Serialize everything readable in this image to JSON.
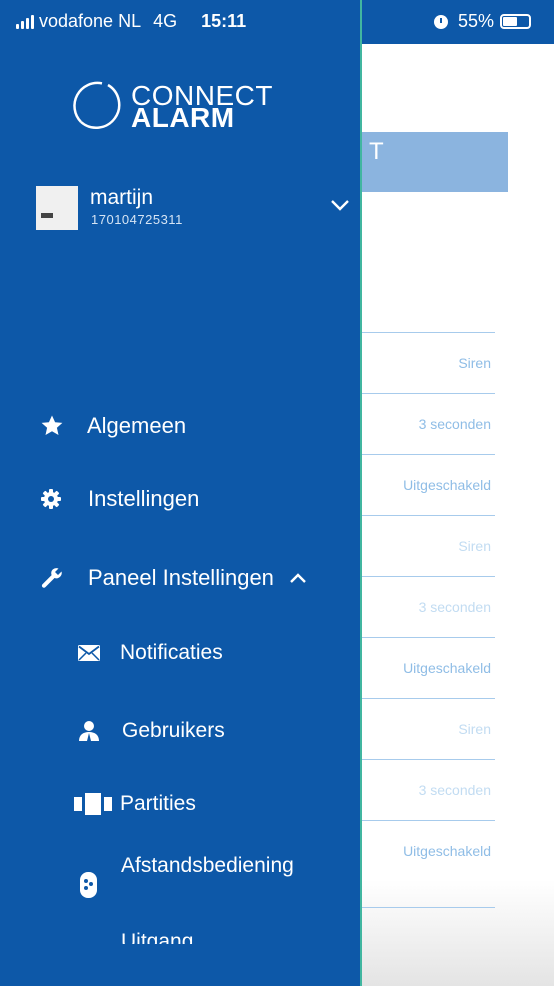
{
  "status_bar": {
    "carrier": "vodafone NL",
    "network": "4G",
    "time": "15:11",
    "battery": "55%",
    "battery_level": 0.55,
    "icons": [
      "signal-icon",
      "alarm-clock-icon",
      "battery-icon"
    ]
  },
  "background": {
    "title_fragment": "T",
    "rows": [
      "Siren",
      "3 seconden",
      "Uitgeschakeld",
      "Siren",
      "3 seconden",
      "Uitgeschakeld",
      "Siren",
      "3 seconden",
      "Uitgeschakeld"
    ]
  },
  "logo": {
    "line1": "CONNECT",
    "line2": "ALARM"
  },
  "account": {
    "name": "martijn",
    "id": "170104725311"
  },
  "menu": {
    "algemeen": {
      "label": "Algemeen",
      "icon": "star-icon"
    },
    "instellingen": {
      "label": "Instellingen",
      "icon": "gear-icon"
    },
    "paneel": {
      "label": "Paneel Instellingen",
      "icon": "wrench-icon",
      "expanded": true
    },
    "submenu": {
      "notificaties": {
        "label": "Notificaties",
        "icon": "envelope-icon"
      },
      "gebruikers": {
        "label": "Gebruikers",
        "icon": "user-icon"
      },
      "partities": {
        "label": "Partities",
        "icon": "partitions-icon"
      },
      "afstandsbediening": {
        "label": "Afstandsbediening",
        "icon": "remote-control-icon"
      },
      "uitgang": {
        "label": "Uitgang"
      }
    }
  },
  "colors": {
    "drawer": "#0d58a8",
    "drawer_edge": "#41b6a0",
    "title_band": "#8bb4df",
    "row_text": "#8fbde6"
  }
}
